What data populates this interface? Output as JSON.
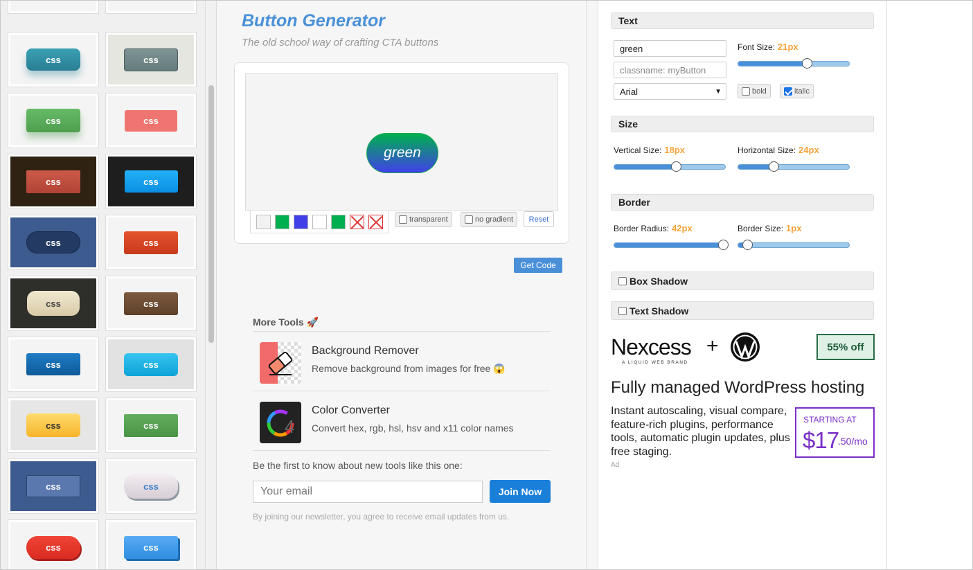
{
  "gallery": {
    "tiles": [
      {
        "label": "css",
        "bg": "#f4f4f4",
        "btn_bg": "linear-gradient(#3aa0b4,#2b7e93)",
        "radius": "8px",
        "w": 78,
        "h": 32,
        "color": "#fff",
        "shadow": "0 8px 10px rgba(40,130,150,0.35)"
      },
      {
        "label": "css",
        "bg": "#e6e6e0",
        "btn_bg": "linear-gradient(#7f9495,#667b7c)",
        "radius": "4px",
        "w": 78,
        "h": 33,
        "color": "#fff",
        "shadow": "inset 0 0 0 1px #4a5c5d"
      },
      {
        "label": "css",
        "bg": "#f4f4f4",
        "btn_bg": "linear-gradient(#66bb66,#4f9e4f)",
        "radius": "4px",
        "w": 78,
        "h": 34,
        "color": "#fff",
        "shadow": "0 8px 10px rgba(60,140,60,0.35)"
      },
      {
        "label": "css",
        "bg": "#f4f4f4",
        "btn_bg": "#f07570",
        "radius": "3px",
        "w": 76,
        "h": 31,
        "color": "#fff",
        "shadow": "none"
      },
      {
        "label": "css",
        "bg": "#2f2213",
        "btn_bg": "linear-gradient(#cc5a4a,#b14334)",
        "radius": "2px",
        "w": 78,
        "h": 33,
        "color": "#fff",
        "shadow": "none"
      },
      {
        "label": "css",
        "bg": "#1e1e1e",
        "btn_bg": "linear-gradient(#23b0f7,#0a8fe2)",
        "radius": "3px",
        "w": 77,
        "h": 32,
        "color": "#fff",
        "shadow": "none"
      },
      {
        "label": "css",
        "bg": "#3d5b8f",
        "btn_bg": "#233b63",
        "radius": "16px",
        "w": 78,
        "h": 32,
        "color": "#fff",
        "shadow": "inset 0 0 0 1px #162a4a"
      },
      {
        "label": "css",
        "bg": "#f4f4f4",
        "btn_bg": "linear-gradient(#e5532d,#c93a1d)",
        "radius": "3px",
        "w": 78,
        "h": 33,
        "color": "#fff",
        "shadow": "none"
      },
      {
        "label": "css",
        "bg": "#2e2e2a",
        "btn_bg": "linear-gradient(#f0e8d0,#d9cba8)",
        "radius": "12px",
        "w": 76,
        "h": 36,
        "color": "#444",
        "shadow": "none"
      },
      {
        "label": "css",
        "bg": "#f4f4f4",
        "btn_bg": "linear-gradient(#7c5a3e,#5e402a)",
        "radius": "3px",
        "w": 78,
        "h": 33,
        "color": "#fff",
        "shadow": "none"
      },
      {
        "label": "css",
        "bg": "#f4f4f4",
        "btn_bg": "linear-gradient(#1e7cc4,#0e5a9a)",
        "radius": "3px",
        "w": 78,
        "h": 32,
        "color": "#fff",
        "shadow": "none"
      },
      {
        "label": "css",
        "bg": "#e2e2e2",
        "btn_bg": "linear-gradient(#36c4f1,#0ea3d7)",
        "radius": "6px",
        "w": 78,
        "h": 33,
        "color": "#fff",
        "shadow": "none"
      },
      {
        "label": "css",
        "bg": "#e6e6e6",
        "btn_bg": "linear-gradient(#fedc6e,#f7b42a)",
        "radius": "6px",
        "w": 78,
        "h": 34,
        "color": "#333",
        "shadow": "none"
      },
      {
        "label": "css",
        "bg": "#f4f4f4",
        "btn_bg": "linear-gradient(#62ad5e,#4b9447)",
        "radius": "2px",
        "w": 78,
        "h": 33,
        "color": "#fff",
        "shadow": "none"
      },
      {
        "label": "css",
        "bg": "#3d5b8f",
        "btn_bg": "#5b78ae",
        "radius": "2px",
        "w": 78,
        "h": 32,
        "color": "#fff",
        "shadow": "inset 0 0 0 1px #2b4470"
      },
      {
        "label": "css",
        "bg": "#f4f4f4",
        "btn_bg": "linear-gradient(#f3eef2,#d7cdd5)",
        "radius": "16px",
        "w": 78,
        "h": 36,
        "color": "#3a80c8",
        "shadow": "2px 3px 0 #8f9aa3"
      },
      {
        "label": "css",
        "bg": "#f4f4f4",
        "btn_bg": "linear-gradient(#f04538,#d92a1e)",
        "radius": "16px",
        "w": 78,
        "h": 33,
        "color": "#fff",
        "shadow": "2px 3px 0 #a8201a"
      },
      {
        "label": "css",
        "bg": "#f4f4f4",
        "btn_bg": "linear-gradient(#59acf4,#2f8de0)",
        "radius": "3px",
        "w": 78,
        "h": 33,
        "color": "#fff",
        "shadow": "3px 3px 0 #1f6cb0"
      }
    ]
  },
  "header": {
    "title": "Button Generator",
    "subtitle": "The old school way of crafting CTA buttons"
  },
  "preview": {
    "button_text": "green",
    "swatches": [
      "#f2f2f2",
      "#00b050",
      "#4040e8",
      "#ffffff",
      "#00b050"
    ],
    "transparent_label": "transparent",
    "no_gradient_label": "no gradient",
    "reset_label": "Reset",
    "get_code_label": "Get Code"
  },
  "more_tools": {
    "title": "More Tools 🚀",
    "items": [
      {
        "name": "Background Remover",
        "desc": "Remove background from images for free 😱"
      },
      {
        "name": "Color Converter",
        "desc": "Convert hex, rgb, hsl, hsv and x11 color names"
      }
    ]
  },
  "newsletter": {
    "text": "Be the first to know about new tools like this one:",
    "email_placeholder": "Your email",
    "join_label": "Join Now",
    "note": "By joining our newsletter, you agree to receive email updates from us."
  },
  "settings": {
    "text_section": "Text",
    "text_value": "green",
    "classname_placeholder": "classname: myButton",
    "font": "Arial",
    "font_size_label": "Font Size:",
    "font_size_value": "21px",
    "font_size_pct": 0.62,
    "bold_label": "bold",
    "italic_label": "italic",
    "size_section": "Size",
    "vertical_label": "Vertical Size:",
    "vertical_value": "18px",
    "vertical_pct": 0.55,
    "horizontal_label": "Horizontal Size:",
    "horizontal_value": "24px",
    "horizontal_pct": 0.3,
    "border_section": "Border",
    "radius_label": "Border Radius:",
    "radius_value": "42px",
    "radius_pct": 1.0,
    "border_size_label": "Border Size:",
    "border_size_value": "1px",
    "border_size_pct": 0.05,
    "box_shadow_label": "Box Shadow",
    "text_shadow_label": "Text Shadow"
  },
  "ad": {
    "brand": "Nexcess",
    "brand_sub": "A LIQUID WEB BRAND",
    "plus": "+",
    "discount": "55% off",
    "headline": "Fully managed WordPress hosting",
    "body": "Instant autoscaling, visual compare, feature-rich plugins, performance tools, automatic plugin updates, plus free staging.",
    "starting": "STARTING AT",
    "price": "$17",
    "cents": ".50/mo",
    "label": "Ad"
  }
}
